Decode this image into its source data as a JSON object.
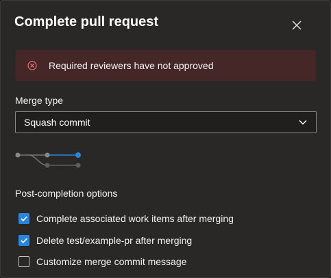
{
  "dialog": {
    "title": "Complete pull request",
    "close_icon": "close-icon"
  },
  "banner": {
    "icon": "error-circle-icon",
    "message": "Required reviewers have not approved",
    "color": "#442726"
  },
  "merge_type": {
    "label": "Merge type",
    "selected": "Squash commit"
  },
  "post_completion": {
    "heading": "Post-completion options",
    "options": [
      {
        "label": "Complete associated work items after merging",
        "checked": true
      },
      {
        "label": "Delete test/example-pr after merging",
        "checked": true
      },
      {
        "label": "Customize merge commit message",
        "checked": false
      }
    ]
  },
  "colors": {
    "accent": "#2886de",
    "error": "#d13438",
    "background": "#292827"
  }
}
